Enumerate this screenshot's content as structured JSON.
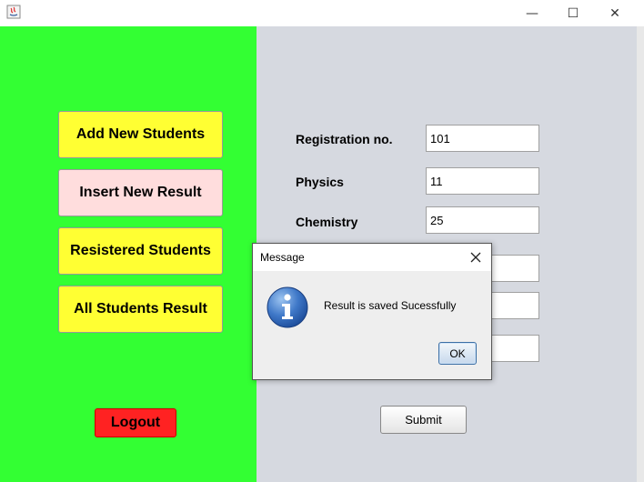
{
  "window": {
    "controls": {
      "minimize": "—",
      "maximize": "☐",
      "close": "✕"
    }
  },
  "sidebar": {
    "items": [
      {
        "label": "Add New Students"
      },
      {
        "label": "Insert New Result"
      },
      {
        "label": "Resistered Students"
      },
      {
        "label": "All Students Result"
      }
    ],
    "logout_label": "Logout",
    "colors": {
      "panel": "#33ff33",
      "button": "#ffff33",
      "active": "#ffdddd",
      "logout": "#ff2222"
    }
  },
  "form": {
    "fields": [
      {
        "label": "Registration no.",
        "value": "101"
      },
      {
        "label": "Physics",
        "value": "11"
      },
      {
        "label": "Chemistry",
        "value": "25"
      }
    ],
    "submit_label": "Submit"
  },
  "dialog": {
    "title": "Message",
    "message": "Result is saved Sucessfully",
    "ok_label": "OK",
    "icon": "info-icon"
  }
}
